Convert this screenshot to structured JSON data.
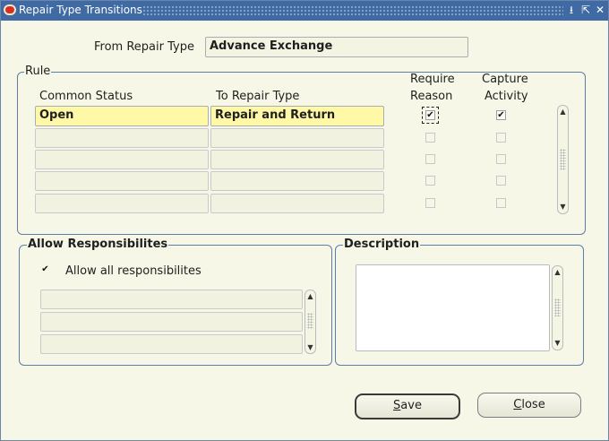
{
  "window": {
    "title": "Repair Type Transitions",
    "controls": {
      "minimize": "⭳",
      "restore": "⇱",
      "close": "✕"
    }
  },
  "header": {
    "from_label": "From Repair Type",
    "from_value": "Advance Exchange"
  },
  "rule": {
    "title": "Rule",
    "col_common_status": "Common Status",
    "col_to_repair_type": "To Repair Type",
    "col_require_reason_1": "Require",
    "col_require_reason_2": "Reason",
    "col_capture_activity_1": "Capture",
    "col_capture_activity_2": "Activity",
    "rows": [
      {
        "common_status": "Open",
        "to_repair_type": "Repair and Return",
        "require_reason": true,
        "capture_activity": true
      },
      {
        "common_status": "",
        "to_repair_type": "",
        "require_reason": false,
        "capture_activity": false
      },
      {
        "common_status": "",
        "to_repair_type": "",
        "require_reason": false,
        "capture_activity": false
      },
      {
        "common_status": "",
        "to_repair_type": "",
        "require_reason": false,
        "capture_activity": false
      },
      {
        "common_status": "",
        "to_repair_type": "",
        "require_reason": false,
        "capture_activity": false
      }
    ]
  },
  "responsibilities": {
    "title": "Allow Responsibilites",
    "allow_all_label": "Allow all responsibilites",
    "allow_all_checked": true,
    "items": [
      "",
      "",
      ""
    ]
  },
  "description": {
    "title": "Description",
    "value": ""
  },
  "buttons": {
    "save": "Save",
    "save_mnemonic": "S",
    "save_rest": "ave",
    "close": "Close",
    "close_mnemonic": "C",
    "close_rest": "lose"
  },
  "icons": {
    "check": "✔",
    "scroll_up": "▲",
    "scroll_down": "▼"
  }
}
